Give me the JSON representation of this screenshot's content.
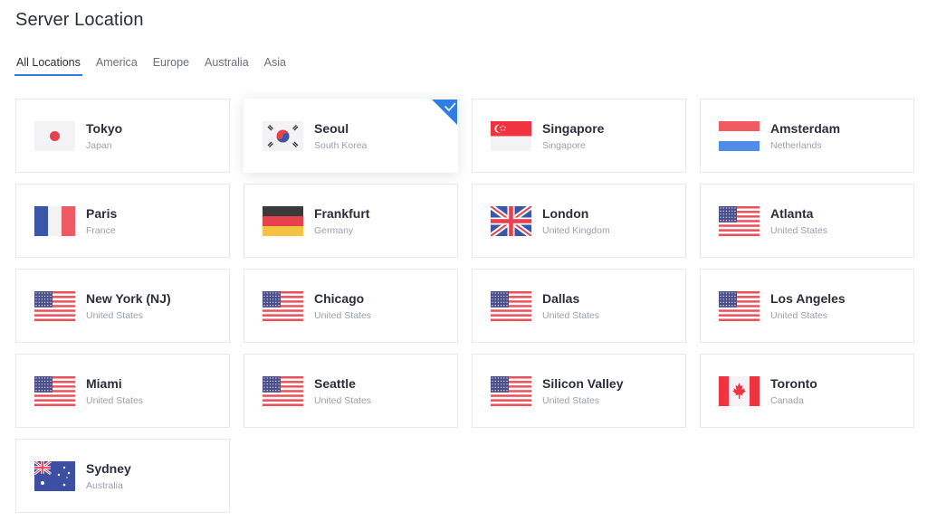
{
  "page": {
    "title": "Server Location"
  },
  "tabs": [
    {
      "label": "All Locations",
      "active": true
    },
    {
      "label": "America"
    },
    {
      "label": "Europe"
    },
    {
      "label": "Australia"
    },
    {
      "label": "Asia"
    }
  ],
  "locations": [
    {
      "city": "Tokyo",
      "country": "Japan",
      "flag": "japan-flag-icon"
    },
    {
      "city": "Seoul",
      "country": "South Korea",
      "flag": "south-korea-flag-icon",
      "selected": true
    },
    {
      "city": "Singapore",
      "country": "Singapore",
      "flag": "singapore-flag-icon"
    },
    {
      "city": "Amsterdam",
      "country": "Netherlands",
      "flag": "netherlands-flag-icon"
    },
    {
      "city": "Paris",
      "country": "France",
      "flag": "france-flag-icon"
    },
    {
      "city": "Frankfurt",
      "country": "Germany",
      "flag": "germany-flag-icon"
    },
    {
      "city": "London",
      "country": "United Kingdom",
      "flag": "uk-flag-icon"
    },
    {
      "city": "Atlanta",
      "country": "United States",
      "flag": "usa-flag-icon"
    },
    {
      "city": "New York (NJ)",
      "country": "United States",
      "flag": "usa-flag-icon"
    },
    {
      "city": "Chicago",
      "country": "United States",
      "flag": "usa-flag-icon"
    },
    {
      "city": "Dallas",
      "country": "United States",
      "flag": "usa-flag-icon"
    },
    {
      "city": "Los Angeles",
      "country": "United States",
      "flag": "usa-flag-icon"
    },
    {
      "city": "Miami",
      "country": "United States",
      "flag": "usa-flag-icon"
    },
    {
      "city": "Seattle",
      "country": "United States",
      "flag": "usa-flag-icon"
    },
    {
      "city": "Silicon Valley",
      "country": "United States",
      "flag": "usa-flag-icon"
    },
    {
      "city": "Toronto",
      "country": "Canada",
      "flag": "canada-flag-icon"
    },
    {
      "city": "Sydney",
      "country": "Australia",
      "flag": "australia-flag-icon"
    }
  ],
  "colors": {
    "accent": "#2f7ee6",
    "card_border": "#e6e8ec",
    "text_primary": "#2b2f3a",
    "text_secondary": "#9aa0ab"
  }
}
